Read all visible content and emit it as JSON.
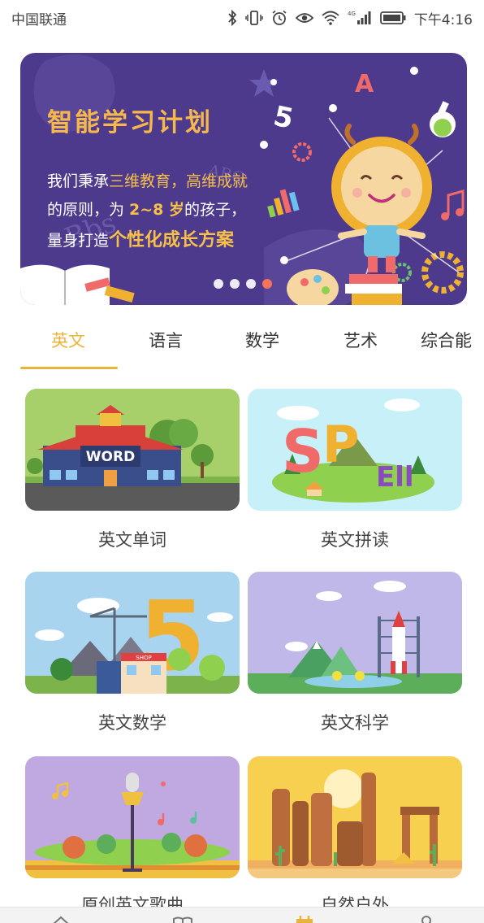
{
  "status_bar": {
    "carrier": "中国联通",
    "network": "4G",
    "time": "下午4:16"
  },
  "banner": {
    "title": "智能学习计划",
    "line1_pre": "我们秉承",
    "line1_hl": "三维教育，高维成就",
    "line2_pre": "的原则，为 ",
    "line2_hl": "2~8 岁",
    "line2_post": "的孩子，",
    "line3_pre": "量身打造",
    "line3_hl": "个性化成长方案",
    "deco_letters": [
      "A",
      "5",
      "ABC"
    ],
    "active_slide_index": 3,
    "slide_count": 4
  },
  "tabs": [
    {
      "label": "英文",
      "active": true
    },
    {
      "label": "语言",
      "active": false
    },
    {
      "label": "数学",
      "active": false
    },
    {
      "label": "艺术",
      "active": false
    },
    {
      "label": "综合能",
      "active": false
    }
  ],
  "courses": [
    {
      "label": "英文单词",
      "image_text": "WORD"
    },
    {
      "label": "英文拼读",
      "image_text": "SPELL"
    },
    {
      "label": "英文数学",
      "image_text": "5",
      "image_sign": "SHOP"
    },
    {
      "label": "英文科学"
    },
    {
      "label": "原创英文歌曲"
    },
    {
      "label": "自然户外"
    }
  ],
  "colors": {
    "accent": "#e9b43a",
    "banner_bg": "#4d3a8c",
    "highlight": "#f7c049"
  }
}
